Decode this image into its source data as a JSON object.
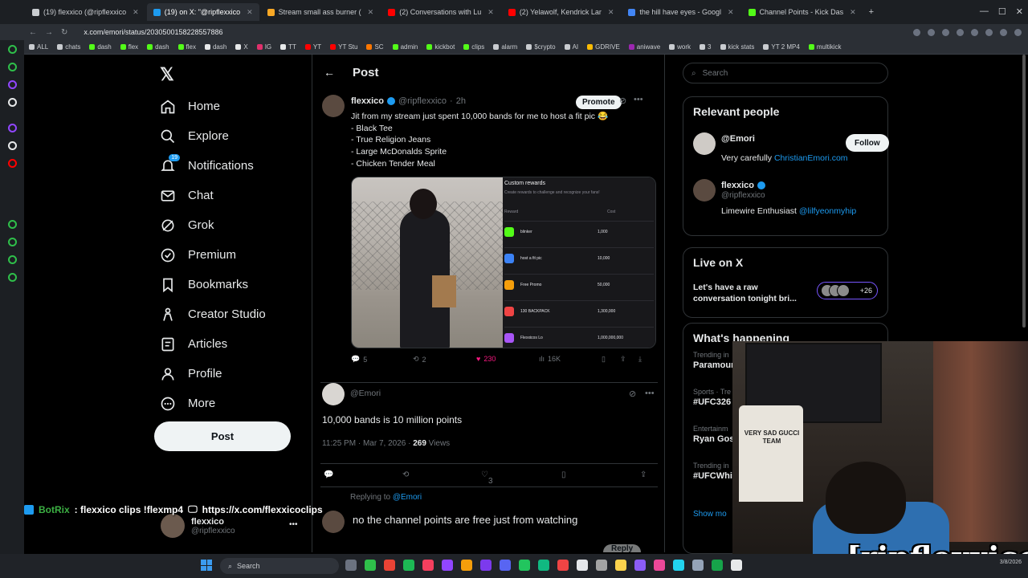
{
  "browser": {
    "tabs": [
      {
        "label": "(19) flexxico (@ripflexxico",
        "color": "#c9ccd0",
        "active": false
      },
      {
        "label": "(19) on X: \"@ripflexxico",
        "color": "#1d9bf0",
        "active": true
      },
      {
        "label": "Stream small ass burner (",
        "color": "#f9a825",
        "active": false
      },
      {
        "label": "(2) Conversations with Lu",
        "color": "#ff0000",
        "active": false
      },
      {
        "label": "(2) Yelawolf, Kendrick Lar",
        "color": "#ff0000",
        "active": false
      },
      {
        "label": "the hill have eyes - Googl",
        "color": "#4285f4",
        "active": false
      },
      {
        "label": "Channel Points - Kick Das",
        "color": "#53fc18",
        "active": false
      }
    ],
    "url": "x.com/emori/status/2030500158228557886",
    "bookmarks": [
      {
        "label": "ALL",
        "color": "#c9ccd0"
      },
      {
        "label": "chats",
        "color": "#c9ccd0"
      },
      {
        "label": "dash",
        "color": "#53fc18"
      },
      {
        "label": "flex",
        "color": "#53fc18"
      },
      {
        "label": "dash",
        "color": "#53fc18"
      },
      {
        "label": "flex",
        "color": "#53fc18"
      },
      {
        "label": "dash",
        "color": "#e7e9ea"
      },
      {
        "label": "X",
        "color": "#e7e9ea"
      },
      {
        "label": "IG",
        "color": "#e1306c"
      },
      {
        "label": "TT",
        "color": "#e7e9ea"
      },
      {
        "label": "YT",
        "color": "#ff0000"
      },
      {
        "label": "YT Stu",
        "color": "#ff0000"
      },
      {
        "label": "SC",
        "color": "#ff7700"
      },
      {
        "label": "admin",
        "color": "#53fc18"
      },
      {
        "label": "kickbot",
        "color": "#53fc18"
      },
      {
        "label": "clips",
        "color": "#53fc18"
      },
      {
        "label": "alarm",
        "color": "#c9ccd0"
      },
      {
        "label": "$crypto",
        "color": "#c9ccd0"
      },
      {
        "label": "AI",
        "color": "#c9ccd0"
      },
      {
        "label": "GDRIVE",
        "color": "#fbbc04"
      },
      {
        "label": "aniwave",
        "color": "#9c27b0"
      },
      {
        "label": "work",
        "color": "#c9ccd0"
      },
      {
        "label": "3",
        "color": "#c9ccd0"
      },
      {
        "label": "kick stats",
        "color": "#c9ccd0"
      },
      {
        "label": "YT 2 MP4",
        "color": "#c9ccd0"
      },
      {
        "label": "multikick",
        "color": "#53fc18"
      }
    ]
  },
  "xnav": {
    "items": [
      {
        "label": "Home",
        "icon": "home-icon"
      },
      {
        "label": "Explore",
        "icon": "search-icon"
      },
      {
        "label": "Notifications",
        "icon": "bell-icon",
        "badge": "19"
      },
      {
        "label": "Chat",
        "icon": "mail-icon"
      },
      {
        "label": "Grok",
        "icon": "grok-icon"
      },
      {
        "label": "Premium",
        "icon": "verified-icon"
      },
      {
        "label": "Bookmarks",
        "icon": "bookmark-icon"
      },
      {
        "label": "Creator Studio",
        "icon": "creator-icon"
      },
      {
        "label": "Articles",
        "icon": "article-icon"
      },
      {
        "label": "Profile",
        "icon": "person-icon"
      },
      {
        "label": "More",
        "icon": "more-icon"
      }
    ],
    "post_label": "Post",
    "account": {
      "name": "flexxico",
      "handle": "@ripflexxico"
    }
  },
  "main": {
    "title": "Post",
    "tweet": {
      "name": "flexxico",
      "handle": "@ripflexxico",
      "time": "2h",
      "promote_label": "Promote",
      "lines": [
        "Jit from my stream just spent 10,000 bands for me to host a fit pic 😂",
        "- Black Tee",
        "- True Religion Jeans",
        "- Large McDonalds Sprite",
        "- Chicken Tender Meal"
      ],
      "rewards_panel": {
        "title": "Custom rewards",
        "subtitle": "Create rewards to challenge and recognize your fans!",
        "col_reward": "Reward",
        "col_cost": "Cost",
        "rows": [
          {
            "name": "blinker",
            "cost": "1,000",
            "color": "#53fc18"
          },
          {
            "name": "host a fit pic",
            "cost": "10,000",
            "color": "#3b82f6"
          },
          {
            "name": "Free Promo",
            "cost": "50,000",
            "color": "#f59e0b"
          },
          {
            "name": "130 BACKPACK",
            "cost": "1,300,000",
            "color": "#ef4444"
          },
          {
            "name": "Flexxicos Lo",
            "cost": "1,000,000,000",
            "color": "#a855f7"
          }
        ]
      },
      "stats": {
        "replies": "5",
        "reposts": "2",
        "likes": "230",
        "views": "16K"
      }
    },
    "reply": {
      "handle": "@Emori",
      "text": "10,000 bands is 10 million points",
      "time": "11:25 PM · Mar 7, 2026 ·",
      "views_count": "269",
      "views_label": "Views",
      "likes": "3"
    },
    "compose": {
      "replying_to_prefix": "Replying to",
      "replying_to_handle": "@Emori",
      "draft": "no the channel points are free just from watching",
      "reply_label": "Reply"
    }
  },
  "right": {
    "search_placeholder": "Search",
    "relevant_people": {
      "title": "Relevant people",
      "people": [
        {
          "name": "@Emori",
          "handle": "",
          "bio": "Very carefully",
          "link": "ChristianEmori.com",
          "follow_label": "Follow"
        },
        {
          "name": "flexxico",
          "handle": "@ripflexxico",
          "bio": "Limewire Enthusiast",
          "link": "@lilfyeonmyhip"
        }
      ]
    },
    "live": {
      "title": "Live on X",
      "text": "Let's have a raw conversation tonight bri...",
      "count": "+26"
    },
    "happening": {
      "title": "What's happening",
      "trends": [
        {
          "meta": "Trending in",
          "name": "Paramount"
        },
        {
          "meta": "Sports · Tre",
          "name": "#UFC326"
        },
        {
          "meta": "Entertainm",
          "name": "Ryan Gos"
        },
        {
          "meta": "Trending in",
          "name": "#UFCWhi"
        }
      ],
      "show_more": "Show mo"
    }
  },
  "overlay": {
    "bot_name": "BotRix",
    "bot_text": ": flexxico clips !flexmp4",
    "bot_link": "https://x.com/flexxicoclips",
    "cam_shirt_text": "VERY SAD GUCCI TEAM",
    "cam_label": "[ripflexxico]"
  },
  "taskbar": {
    "search_label": "Search",
    "clock": "3/8/2026"
  }
}
